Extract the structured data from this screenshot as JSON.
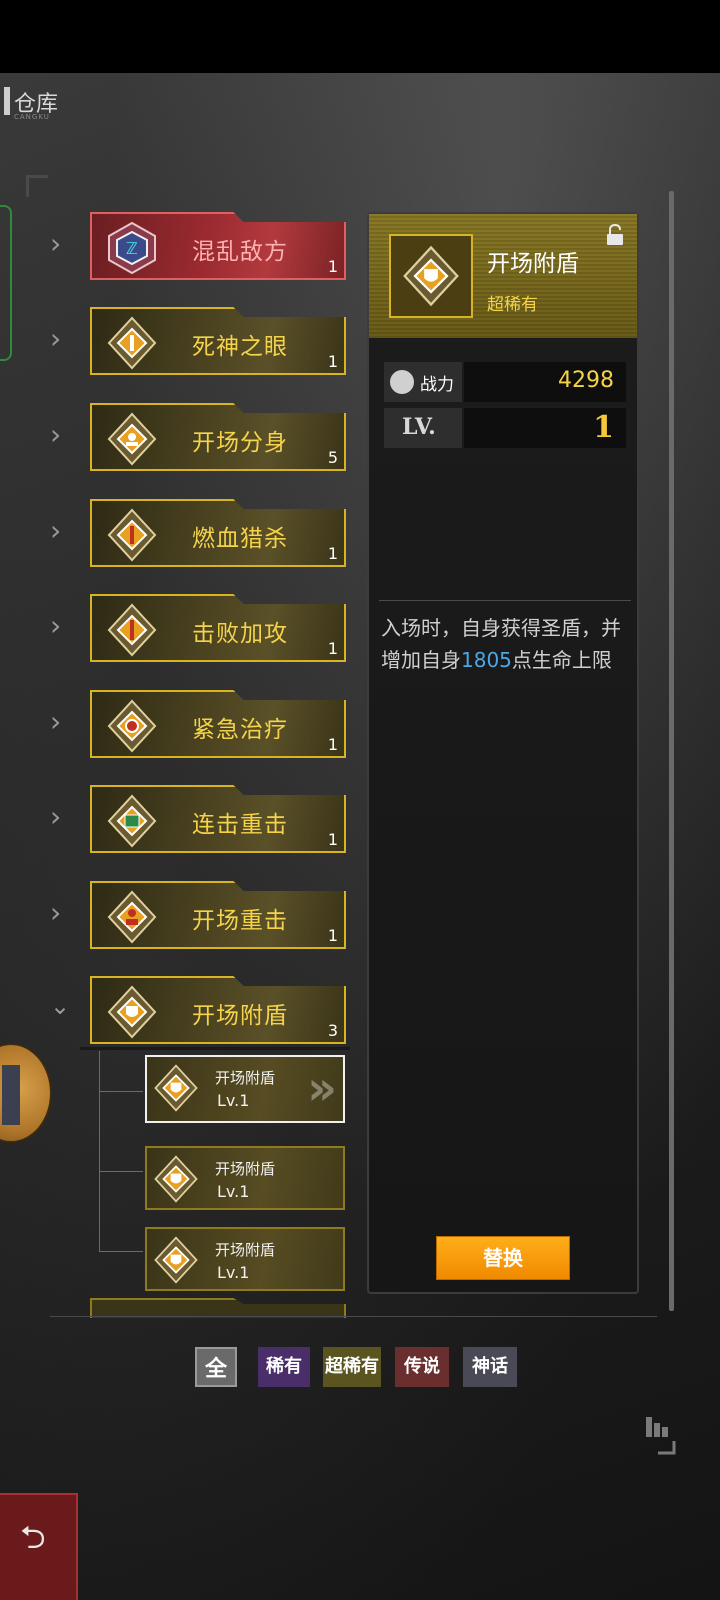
{
  "header": {
    "title": "仓库",
    "subtitle": "CANGKU"
  },
  "skills": [
    {
      "name": "混乱敌方",
      "count": "1",
      "rarity": "legend",
      "expanded": false
    },
    {
      "name": "死神之眼",
      "count": "1",
      "rarity": "super",
      "expanded": false
    },
    {
      "name": "开场分身",
      "count": "5",
      "rarity": "super",
      "expanded": false
    },
    {
      "name": "燃血猎杀",
      "count": "1",
      "rarity": "super",
      "expanded": false
    },
    {
      "name": "击败加攻",
      "count": "1",
      "rarity": "super",
      "expanded": false
    },
    {
      "name": "紧急治疗",
      "count": "1",
      "rarity": "super",
      "expanded": false
    },
    {
      "name": "连击重击",
      "count": "1",
      "rarity": "super",
      "expanded": false
    },
    {
      "name": "开场重击",
      "count": "1",
      "rarity": "super",
      "expanded": false
    },
    {
      "name": "开场附盾",
      "count": "3",
      "rarity": "super",
      "expanded": true
    }
  ],
  "sub_items": [
    {
      "name": "开场附盾",
      "level": "Lv.1",
      "selected": true
    },
    {
      "name": "开场附盾",
      "level": "Lv.1",
      "selected": false
    },
    {
      "name": "开场附盾",
      "level": "Lv.1",
      "selected": false
    }
  ],
  "details": {
    "title": "开场附盾",
    "rarity": "超稀有",
    "power_label": "战力",
    "power_value": "4298",
    "level_label": "LV.",
    "level_value": "1",
    "desc_part1": "入场时，自身获得圣盾，并增加自身",
    "desc_highlight": "1805",
    "desc_part2": "点生命上限",
    "replace_label": "替换"
  },
  "filters": {
    "all": "全",
    "rare": "稀有",
    "super_rare": "超稀有",
    "legend": "传说",
    "myth": "神话"
  },
  "icons": {
    "back": "back-arrow-icon",
    "lock": "unlock-icon",
    "power": "fist-icon",
    "expand": "chevron-right-icon",
    "collapse": "chevron-down-icon"
  },
  "colors": {
    "gold": "#d8b424",
    "legend_red": "#b23a3e",
    "highlight_blue": "#4aa8e8",
    "button_orange": "#f08a00"
  }
}
